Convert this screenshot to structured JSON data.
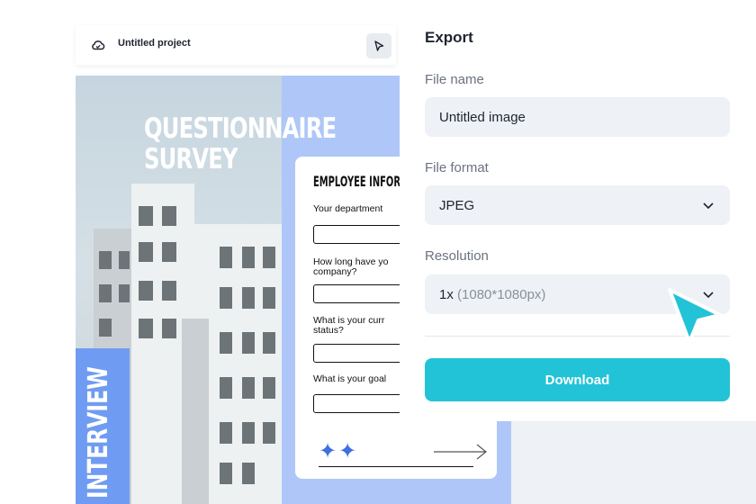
{
  "editor": {
    "project_title": "Untitled project",
    "cloud_icon": "cloud-sync-icon",
    "cursor_icon": "cursor-icon"
  },
  "poster": {
    "title": "QUESTIONNAIRE\nSURVEY",
    "side_label": "INTERVIEW",
    "form": {
      "title": "EMPLOYEE INFORM",
      "questions": [
        "Your department",
        "How long have yo company?",
        "What is your curr status?",
        "What is your goal"
      ],
      "sparkles": "✦✦"
    }
  },
  "export": {
    "title": "Export",
    "file_name_label": "File name",
    "file_name_value": "Untitled image",
    "file_format_label": "File format",
    "file_format_value": "JPEG",
    "resolution_label": "Resolution",
    "resolution_value": "1x",
    "resolution_detail": "(1080*1080px)",
    "download_label": "Download"
  },
  "colors": {
    "accent": "#22c3d6",
    "poster_blue": "#aec7f8",
    "band_blue": "#6f9cf2"
  }
}
